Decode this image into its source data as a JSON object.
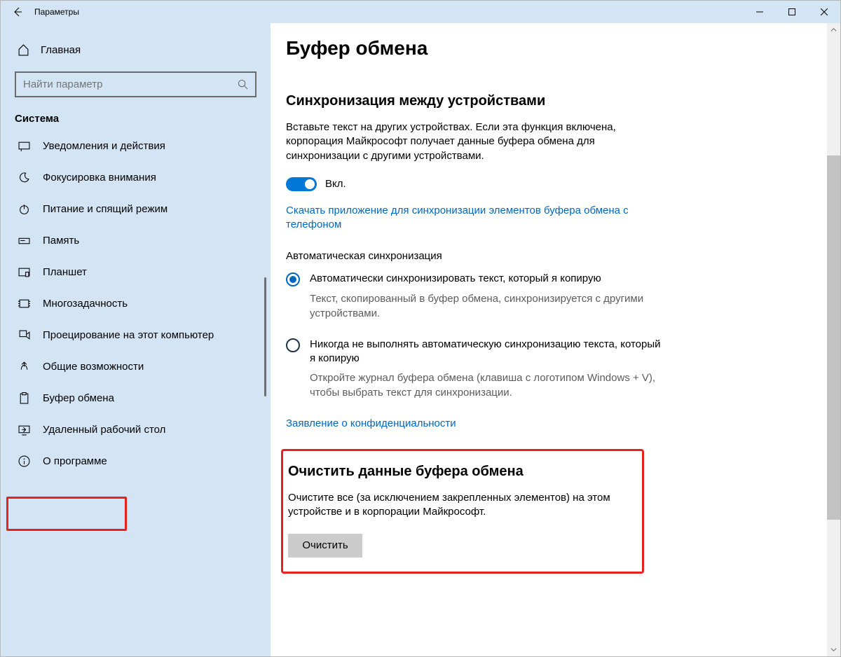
{
  "title_bar": {
    "title": "Параметры"
  },
  "sidebar": {
    "home": "Главная",
    "search_placeholder": "Найти параметр",
    "section": "Система",
    "items": [
      {
        "label": "Уведомления и действия"
      },
      {
        "label": "Фокусировка внимания"
      },
      {
        "label": "Питание и спящий режим"
      },
      {
        "label": "Память"
      },
      {
        "label": "Планшет"
      },
      {
        "label": "Многозадачность"
      },
      {
        "label": "Проецирование на этот компьютер"
      },
      {
        "label": "Общие возможности"
      },
      {
        "label": "Буфер обмена"
      },
      {
        "label": "Удаленный рабочий стол"
      },
      {
        "label": "О программе"
      }
    ]
  },
  "main": {
    "heading": "Буфер обмена",
    "sync": {
      "heading": "Синхронизация между устройствами",
      "description": "Вставьте текст на других устройствах. Если эта функция включена, корпорация Майкрософт получает данные буфера обмена для синхронизации с другими устройствами.",
      "toggle_state": "on",
      "toggle_label": "Вкл.",
      "download_link": "Скачать приложение для синхронизации элементов буфера обмена с телефоном"
    },
    "auto_sync": {
      "heading": "Автоматическая синхронизация",
      "options": [
        {
          "label": "Автоматически синхронизировать текст, который я копирую",
          "desc": "Текст, скопированный в буфер обмена, синхронизируется с другими устройствами.",
          "selected": true
        },
        {
          "label": "Никогда не выполнять автоматическую синхронизацию текста, который я копирую",
          "desc": "Откройте журнал буфера обмена (клавиша с логотипом Windows + V), чтобы выбрать текст для синхронизации.",
          "selected": false
        }
      ]
    },
    "privacy_link": "Заявление о конфиденциальности",
    "clear": {
      "heading": "Очистить данные буфера обмена",
      "description": "Очистите все (за исключением закрепленных элементов) на этом устройстве и в корпорации Майкрософт.",
      "button": "Очистить"
    }
  }
}
